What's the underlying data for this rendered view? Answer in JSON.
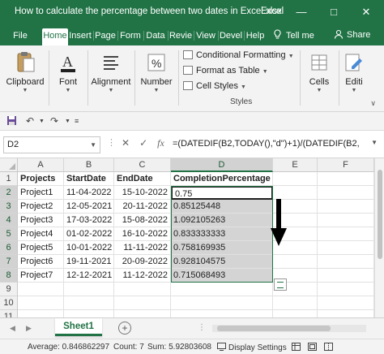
{
  "window": {
    "title": "How to calculate the percentage between two dates in Excel.xlsx",
    "app": "Excel",
    "minimize": "—",
    "maximize": "□",
    "close": "✕"
  },
  "tabs": [
    "File",
    "Home",
    "Insert",
    "Page",
    "Form",
    "Data",
    "Revie",
    "View",
    "Devel",
    "Help"
  ],
  "active_tab": "Home",
  "tell_me": "Tell me",
  "share": "Share",
  "ribbon": {
    "clipboard": "Clipboard",
    "font": "Font",
    "alignment": "Alignment",
    "number": "Number",
    "conditional_formatting": "Conditional Formatting",
    "format_as_table": "Format as Table",
    "cell_styles": "Cell Styles",
    "styles_group": "Styles",
    "cells": "Cells",
    "editing": "Editi"
  },
  "formula_bar": {
    "name_box": "D2",
    "fx": "fx",
    "formula": "=(DATEDIF(B2,TODAY(),\"d\")+1)/(DATEDIF(B2,"
  },
  "columns": [
    "A",
    "B",
    "C",
    "D",
    "E",
    "F"
  ],
  "rows": [
    "1",
    "2",
    "3",
    "4",
    "5",
    "6",
    "7",
    "8",
    "9",
    "10",
    "11"
  ],
  "sheet": {
    "headers": [
      "Projects",
      "StartDate",
      "EndDate",
      "CompletionPercentage"
    ],
    "data": [
      [
        "Project1",
        "11-04-2022",
        "15-10-2022",
        "0.75"
      ],
      [
        "Project2",
        "12-05-2021",
        "20-11-2022",
        "0.85125448"
      ],
      [
        "Project3",
        "17-03-2022",
        "15-08-2022",
        "1.092105263"
      ],
      [
        "Project4",
        "01-02-2022",
        "16-10-2022",
        "0.833333333"
      ],
      [
        "Project5",
        "10-01-2022",
        "11-11-2022",
        "0.758169935"
      ],
      [
        "Project6",
        "19-11-2021",
        "20-09-2022",
        "0.928104575"
      ],
      [
        "Project7",
        "12-12-2021",
        "11-12-2022",
        "0.715068493"
      ]
    ]
  },
  "sheet_tab": "Sheet1",
  "add_sheet": "+",
  "status": {
    "average": "Average: 0.846862297",
    "count": "Count: 7",
    "sum": "Sum: 5.92803608",
    "display_settings": "Display Settings"
  },
  "colors": {
    "excel_green": "#217346",
    "selection_fill": "#d4d4d4"
  }
}
